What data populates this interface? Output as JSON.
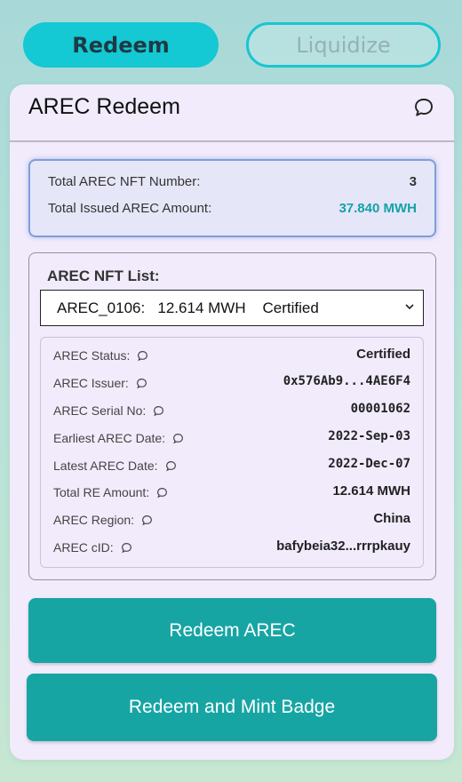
{
  "tabs": {
    "redeem_label": "Redeem",
    "liquidize_label": "Liquidize"
  },
  "card": {
    "title": "AREC Redeem",
    "icon": "chat-bubble-icon"
  },
  "summary": {
    "nft_number_label": "Total AREC NFT Number:",
    "nft_number_value": "3",
    "issued_amount_label": "Total Issued AREC Amount:",
    "issued_amount_value": "37.840 MWH"
  },
  "nft_list": {
    "label": "AREC NFT List:",
    "selected": "AREC_0106:   12.614 MWH    Certified"
  },
  "details": [
    {
      "label": "AREC Status:",
      "value": "Certified"
    },
    {
      "label": "AREC Issuer:",
      "value": "0x576Ab9...4AE6F4"
    },
    {
      "label": "AREC Serial No:",
      "value": "00001062"
    },
    {
      "label": "Earliest AREC Date:",
      "value": "2022-Sep-03"
    },
    {
      "label": "Latest AREC Date:",
      "value": "2022-Dec-07"
    },
    {
      "label": "Total RE Amount:",
      "value": "12.614 MWH"
    },
    {
      "label": "AREC Region:",
      "value": "China"
    },
    {
      "label": "AREC cID:",
      "value": "bafybeia32...rrrpkauy"
    }
  ],
  "buttons": {
    "redeem_label": "Redeem AREC",
    "mint_label": "Redeem and Mint Badge"
  },
  "colors": {
    "accent_teal": "#17a5a4",
    "tab_active": "#14c8d4",
    "amount_teal": "#12a3a4"
  }
}
